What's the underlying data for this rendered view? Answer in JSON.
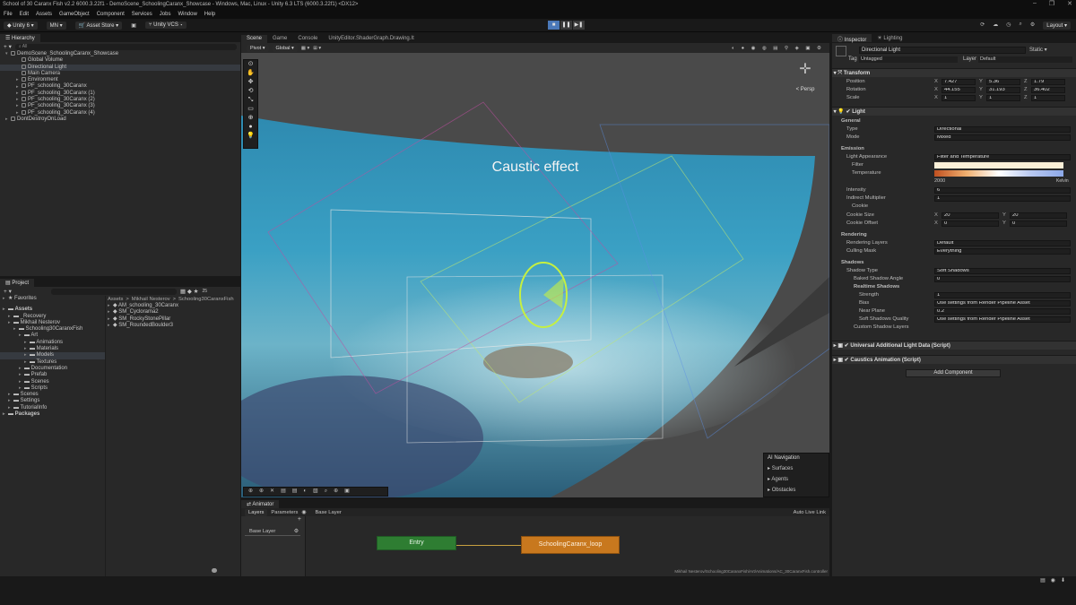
{
  "window": {
    "title": "School of 30 Caranx Fish v2.2 6000.3.22f1 - DemoScene_SchoolingCaranx_Showcase - Windows, Mac, Linux - Unity 6.3 LTS (6000.3.22f1) <DX12>"
  },
  "menu": [
    "File",
    "Edit",
    "Assets",
    "GameObject",
    "Component",
    "Services",
    "Jobs",
    "Window",
    "Help"
  ],
  "toolbar": {
    "account": "Unity 6",
    "user": "MN",
    "asset_store": "Asset Store",
    "vcs": "Unity VCS",
    "layout": "Layout"
  },
  "hierarchy": {
    "tab": "Hierarchy",
    "search": "All",
    "items": [
      {
        "label": "DemoScene_SchoolingCaranx_Showcase",
        "indent": 0,
        "caret": "▾",
        "sel": false
      },
      {
        "label": "Global Volume",
        "indent": 2,
        "caret": "",
        "sel": false
      },
      {
        "label": "Directional Light",
        "indent": 2,
        "caret": "",
        "sel": true
      },
      {
        "label": "Main Camera",
        "indent": 2,
        "caret": "",
        "sel": false
      },
      {
        "label": "Environment",
        "indent": 2,
        "caret": "▸",
        "sel": false
      },
      {
        "label": "PF_schooling_30Caranx",
        "indent": 2,
        "caret": "▸",
        "sel": false
      },
      {
        "label": "PF_schooling_30Caranx (1)",
        "indent": 2,
        "caret": "▸",
        "sel": false
      },
      {
        "label": "PF_schooling_30Caranx (2)",
        "indent": 2,
        "caret": "▸",
        "sel": false
      },
      {
        "label": "PF_schooling_30Caranx (3)",
        "indent": 2,
        "caret": "▸",
        "sel": false
      },
      {
        "label": "PF_schooling_30Caranx (4)",
        "indent": 2,
        "caret": "▸",
        "sel": false
      },
      {
        "label": "DontDestroyOnLoad",
        "indent": 0,
        "caret": "▸",
        "sel": false
      }
    ]
  },
  "project": {
    "tab": "Project",
    "count": "25",
    "favorites": "Favorites",
    "tree": [
      {
        "label": "Assets",
        "indent": 0,
        "bold": true
      },
      {
        "label": "_Recovery",
        "indent": 1
      },
      {
        "label": "Mikhail Nesterov",
        "indent": 1
      },
      {
        "label": "Schooling30CaranxFish",
        "indent": 2
      },
      {
        "label": "Art",
        "indent": 3
      },
      {
        "label": "Animations",
        "indent": 4
      },
      {
        "label": "Materials",
        "indent": 4
      },
      {
        "label": "Models",
        "indent": 4,
        "sel": true
      },
      {
        "label": "Textures",
        "indent": 4
      },
      {
        "label": "Documentation",
        "indent": 3
      },
      {
        "label": "Prefab",
        "indent": 3
      },
      {
        "label": "Scenes",
        "indent": 3
      },
      {
        "label": "Scripts",
        "indent": 3
      },
      {
        "label": "Scenes",
        "indent": 1
      },
      {
        "label": "Settings",
        "indent": 1
      },
      {
        "label": "TutorialInfo",
        "indent": 1
      },
      {
        "label": "Packages",
        "indent": 0,
        "bold": true
      }
    ],
    "breadcrumb": [
      "Assets",
      "Mikhail Nesterov",
      "Schooling30CaranxFish"
    ],
    "files": [
      "AM_schooling_30Caranx",
      "SM_Cyclorama2",
      "SM_RockyStonePillar",
      "SM_RoundedBoulder3"
    ]
  },
  "scene": {
    "tabs": [
      "Scene",
      "Game",
      "Console",
      "UnityEditor.ShaderGraph.Drawing.It"
    ],
    "pivot": "Pivot",
    "global": "Global",
    "caption": "Caustic effect",
    "persp": "< Persp",
    "ai_nav": {
      "title": "AI Navigation",
      "items": [
        "Surfaces",
        "Agents",
        "Obstacles"
      ]
    }
  },
  "inspector": {
    "tabs": [
      "Inspector",
      "Lighting"
    ],
    "object_name": "Directional Light",
    "static": "Static",
    "tag_label": "Tag",
    "tag": "Untagged",
    "layer_label": "Layer",
    "layer": "Default",
    "transform": {
      "title": "Transform",
      "position": {
        "label": "Position",
        "x": "7.427",
        "y": "5.36",
        "z": "1.79"
      },
      "rotation": {
        "label": "Rotation",
        "x": "44.155",
        "y": "31.193",
        "z": "36.402"
      },
      "scale": {
        "label": "Scale",
        "x": "1",
        "y": "1",
        "z": "1"
      }
    },
    "light": {
      "title": "Light",
      "general": "General",
      "type_label": "Type",
      "type": "Directional",
      "mode_label": "Mode",
      "mode": "Mixed",
      "emission": "Emission",
      "appearance_label": "Light Appearance",
      "appearance": "Filter and Temperature",
      "filter_label": "Filter",
      "temp_label": "Temperature",
      "temp_value": "2000",
      "temp_unit": "Kelvin",
      "intensity_label": "Intensity",
      "intensity": "6",
      "indirect_label": "Indirect Multiplier",
      "indirect": "1",
      "cookie_label": "Cookie",
      "cookie_size_label": "Cookie Size",
      "cookie_size_x": "20",
      "cookie_size_y": "20",
      "cookie_offset_label": "Cookie Offset",
      "cookie_offset_x": "0",
      "cookie_offset_y": "0",
      "rendering": "Rendering",
      "rendering_layers_label": "Rendering Layers",
      "rendering_layers": "Default",
      "culling_label": "Culling Mask",
      "culling": "Everything",
      "shadows": "Shadows",
      "shadow_type_label": "Shadow Type",
      "shadow_type": "Soft Shadows",
      "baked_angle_label": "Baked Shadow Angle",
      "baked_angle": "0",
      "realtime": "Realtime Shadows",
      "strength_label": "Strength",
      "strength": "1",
      "bias_label": "Bias",
      "bias": "Use settings from Render Pipeline Asset",
      "near_label": "Near Plane",
      "near": "0.2",
      "quality_label": "Soft Shadows Quality",
      "quality": "Use settings from Render Pipeline Asset",
      "custom_label": "Custom Shadow Layers"
    },
    "additional": "Universal Additional Light Data (Script)",
    "caustics": "Caustics Animation (Script)",
    "add_component": "Add Component"
  },
  "animator": {
    "tab": "Animator",
    "layers": "Layers",
    "parameters": "Parameters",
    "base_layer": "Base Layer",
    "base_layer_item": "Base Layer",
    "auto_live": "Auto Live Link",
    "entry": "Entry",
    "state": "SchoolingCaranx_loop",
    "path": "Mikhail Nesterov/Schooling30CaranxFish/Art/Animations/AC_30CaranxFish.controller"
  },
  "colors": {
    "selection": "#2c5d87",
    "state_orange": "#c8781e",
    "entry_green": "#2e7d32"
  }
}
